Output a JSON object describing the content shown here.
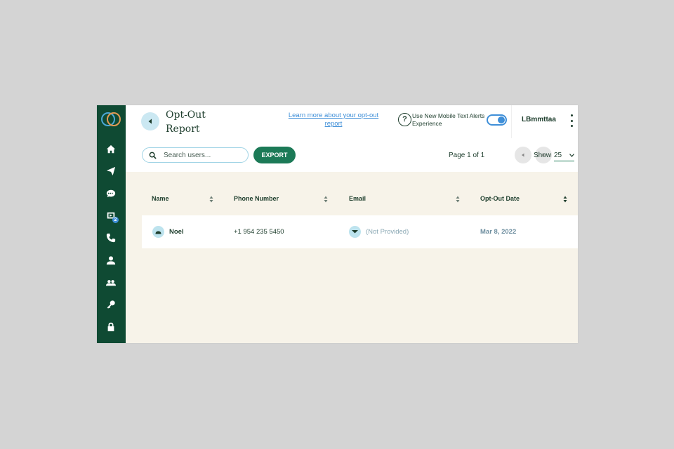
{
  "header": {
    "title": "Opt-Out Report",
    "learn_more": "Learn more about your opt-out report",
    "help_text": "Use New Mobile Text Alerts Experience",
    "username": "LBmmttaa",
    "toggle_on": true
  },
  "toolbar": {
    "search_placeholder": "Search users...",
    "export_label": "EXPORT",
    "pagination": "Page 1 of 1",
    "show_label": "Show",
    "show_value": "25"
  },
  "table": {
    "columns": [
      "Name",
      "Phone Number",
      "Email",
      "Opt-Out Date"
    ],
    "rows": [
      {
        "name": "Noel",
        "phone": "+1 954 235 5450",
        "email": "(Not Provided)",
        "date": "Mar 8, 2022"
      }
    ]
  },
  "sidebar": {
    "items": [
      "home-icon",
      "send-icon",
      "chat-icon",
      "broadcast-icon",
      "phone-icon",
      "user-icon",
      "users-icon",
      "key-icon",
      "lock-icon"
    ],
    "badge": "2"
  },
  "colors": {
    "sidebar": "#0f4a33",
    "accent": "#1c7a57",
    "link": "#3f8fd8",
    "content_bg": "#f7f3e9"
  }
}
